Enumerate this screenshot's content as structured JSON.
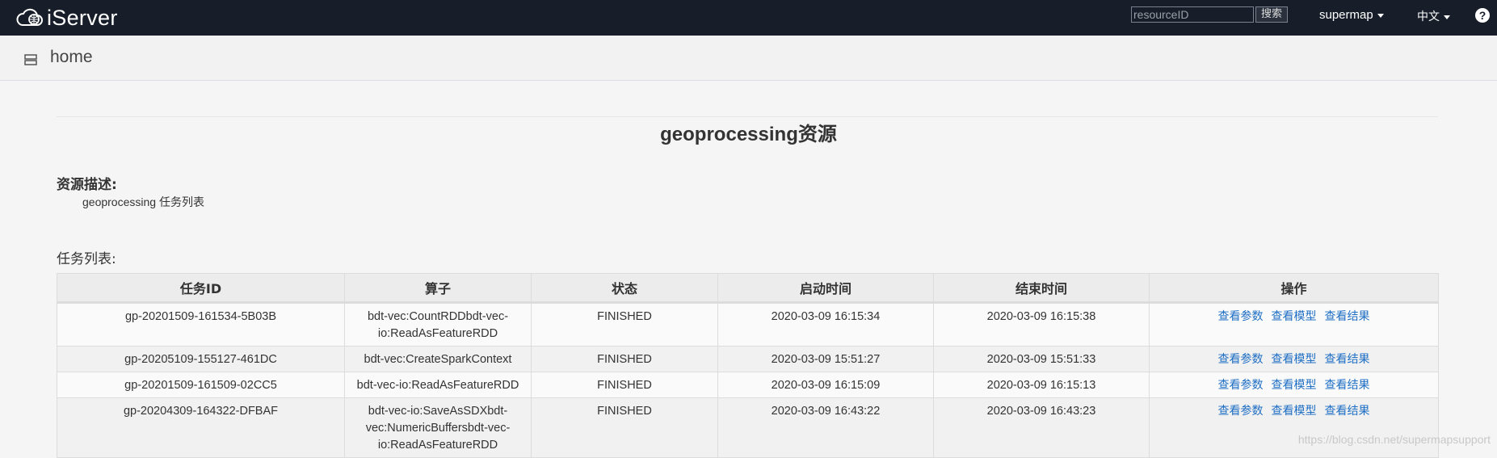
{
  "navbar": {
    "logo_text": "iServer",
    "search_placeholder": "resourceID",
    "search_button": "搜索",
    "user_menu": "supermap",
    "language_menu": "中文",
    "help": "?"
  },
  "subheader": {
    "title": "home"
  },
  "page": {
    "title": "geoprocessing资源",
    "description_label": "资源描述:",
    "description": "geoprocessing 任务列表",
    "task_list_label": "任务列表:"
  },
  "table": {
    "headers": [
      "任务ID",
      "算子",
      "状态",
      "启动时间",
      "结束时间",
      "操作"
    ],
    "action_labels": [
      "查看参数",
      "查看模型",
      "查看结果"
    ],
    "rows": [
      {
        "id": "gp-20201509-161534-5B03B",
        "operator": "bdt-vec:CountRDDbdt-vec-io:ReadAsFeatureRDD",
        "status": "FINISHED",
        "start": "2020-03-09 16:15:34",
        "end": "2020-03-09 16:15:38"
      },
      {
        "id": "gp-20205109-155127-461DC",
        "operator": "bdt-vec:CreateSparkContext",
        "status": "FINISHED",
        "start": "2020-03-09 15:51:27",
        "end": "2020-03-09 15:51:33"
      },
      {
        "id": "gp-20201509-161509-02CC5",
        "operator": "bdt-vec-io:ReadAsFeatureRDD",
        "status": "FINISHED",
        "start": "2020-03-09 16:15:09",
        "end": "2020-03-09 16:15:13"
      },
      {
        "id": "gp-20204309-164322-DFBAF",
        "operator": "bdt-vec-io:SaveAsSDXbdt-vec:NumericBuffersbdt-vec-io:ReadAsFeatureRDD",
        "status": "FINISHED",
        "start": "2020-03-09 16:43:22",
        "end": "2020-03-09 16:43:23"
      }
    ]
  },
  "watermark": "https://blog.csdn.net/supermapsupport"
}
